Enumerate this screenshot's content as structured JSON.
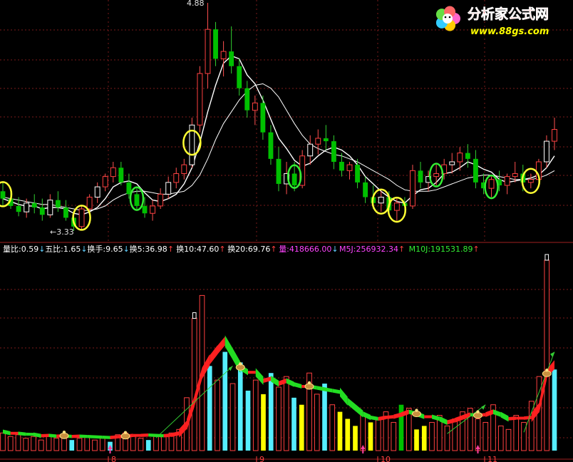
{
  "logo": {
    "name": "分析家公式网",
    "url": "www.88gs.com"
  },
  "colors": {
    "up": "#e00000",
    "down": "#00c000",
    "ma_fast": "#ffffff",
    "ma_slow": "#ffffff",
    "circle_yellow": "#ffff33",
    "circle_green": "#33ee33",
    "vol_cyan": "#55eeff",
    "vol_yellow": "#ffff00",
    "ribbon_red": "#ff2020",
    "ribbon_green": "#22dd22",
    "grid": "#7a1a1a",
    "axis_text": "#ff4040"
  },
  "chart_data": [
    {
      "type": "candlestick",
      "annotations": [
        {
          "text": "4.88",
          "kind": "max"
        },
        {
          "text": "←3.33",
          "kind": "min"
        }
      ],
      "ohlc": [
        [
          3.6,
          3.66,
          3.5,
          3.55
        ],
        [
          3.55,
          3.62,
          3.48,
          3.5
        ],
        [
          3.5,
          3.56,
          3.43,
          3.46
        ],
        [
          3.46,
          3.55,
          3.42,
          3.52
        ],
        [
          3.52,
          3.58,
          3.45,
          3.49
        ],
        [
          3.49,
          3.55,
          3.4,
          3.44
        ],
        [
          3.44,
          3.58,
          3.42,
          3.54
        ],
        [
          3.54,
          3.6,
          3.46,
          3.49
        ],
        [
          3.49,
          3.54,
          3.4,
          3.42
        ],
        [
          3.42,
          3.46,
          3.33,
          3.36
        ],
        [
          3.36,
          3.5,
          3.34,
          3.48
        ],
        [
          3.48,
          3.58,
          3.45,
          3.56
        ],
        [
          3.56,
          3.66,
          3.52,
          3.63
        ],
        [
          3.63,
          3.72,
          3.6,
          3.7
        ],
        [
          3.7,
          3.8,
          3.66,
          3.76
        ],
        [
          3.76,
          3.8,
          3.64,
          3.66
        ],
        [
          3.66,
          3.72,
          3.55,
          3.58
        ],
        [
          3.58,
          3.62,
          3.48,
          3.5
        ],
        [
          3.5,
          3.56,
          3.42,
          3.45
        ],
        [
          3.45,
          3.54,
          3.4,
          3.5
        ],
        [
          3.5,
          3.62,
          3.48,
          3.58
        ],
        [
          3.58,
          3.7,
          3.55,
          3.66
        ],
        [
          3.66,
          3.76,
          3.62,
          3.72
        ],
        [
          3.72,
          3.82,
          3.68,
          3.78
        ],
        [
          3.78,
          4.1,
          3.76,
          4.05
        ],
        [
          4.05,
          4.45,
          4.0,
          4.4
        ],
        [
          4.4,
          4.88,
          4.3,
          4.7
        ],
        [
          4.7,
          4.75,
          4.45,
          4.5
        ],
        [
          4.5,
          4.62,
          4.38,
          4.55
        ],
        [
          4.55,
          4.72,
          4.4,
          4.45
        ],
        [
          4.45,
          4.5,
          4.25,
          4.3
        ],
        [
          4.3,
          4.35,
          4.1,
          4.15
        ],
        [
          4.15,
          4.25,
          4.05,
          4.2
        ],
        [
          4.2,
          4.25,
          3.95,
          4.0
        ],
        [
          4.0,
          4.05,
          3.78,
          3.82
        ],
        [
          3.82,
          3.9,
          3.6,
          3.65
        ],
        [
          3.65,
          3.8,
          3.58,
          3.72
        ],
        [
          3.72,
          3.8,
          3.6,
          3.64
        ],
        [
          3.64,
          3.88,
          3.62,
          3.84
        ],
        [
          3.84,
          3.98,
          3.78,
          3.92
        ],
        [
          3.92,
          4.02,
          3.85,
          3.96
        ],
        [
          3.96,
          4.05,
          3.88,
          3.94
        ],
        [
          3.94,
          3.98,
          3.75,
          3.8
        ],
        [
          3.8,
          3.86,
          3.7,
          3.74
        ],
        [
          3.74,
          3.8,
          3.68,
          3.78
        ],
        [
          3.78,
          3.82,
          3.62,
          3.66
        ],
        [
          3.66,
          3.7,
          3.52,
          3.56
        ],
        [
          3.56,
          3.64,
          3.48,
          3.52
        ],
        [
          3.52,
          3.6,
          3.46,
          3.56
        ],
        [
          3.56,
          3.6,
          3.44,
          3.47
        ],
        [
          3.47,
          3.55,
          3.4,
          3.52
        ],
        [
          3.52,
          3.56,
          3.45,
          3.5
        ],
        [
          3.5,
          3.78,
          3.48,
          3.74
        ],
        [
          3.74,
          3.8,
          3.62,
          3.66
        ],
        [
          3.66,
          3.74,
          3.6,
          3.7
        ],
        [
          3.7,
          3.78,
          3.64,
          3.72
        ],
        [
          3.72,
          3.82,
          3.68,
          3.78
        ],
        [
          3.78,
          3.86,
          3.72,
          3.8
        ],
        [
          3.8,
          3.9,
          3.74,
          3.86
        ],
        [
          3.86,
          3.92,
          3.76,
          3.82
        ],
        [
          3.82,
          3.88,
          3.62,
          3.66
        ],
        [
          3.66,
          3.72,
          3.58,
          3.62
        ],
        [
          3.62,
          3.7,
          3.56,
          3.68
        ],
        [
          3.68,
          3.74,
          3.6,
          3.64
        ],
        [
          3.64,
          3.72,
          3.58,
          3.7
        ],
        [
          3.7,
          3.8,
          3.66,
          3.72
        ],
        [
          3.72,
          3.78,
          3.6,
          3.66
        ],
        [
          3.66,
          3.72,
          3.62,
          3.68
        ],
        [
          3.68,
          3.82,
          3.66,
          3.8
        ],
        [
          3.8,
          3.98,
          3.76,
          3.94
        ],
        [
          3.94,
          4.1,
          3.88,
          4.02
        ]
      ],
      "ma5": [
        3.55,
        3.53,
        3.51,
        3.5,
        3.5,
        3.48,
        3.49,
        3.49,
        3.48,
        3.45,
        3.44,
        3.46,
        3.49,
        3.55,
        3.63,
        3.66,
        3.67,
        3.65,
        3.59,
        3.54,
        3.53,
        3.55,
        3.58,
        3.65,
        3.76,
        3.93,
        4.14,
        4.32,
        4.47,
        4.52,
        4.5,
        4.39,
        4.33,
        4.22,
        4.09,
        3.96,
        3.89,
        3.81,
        3.77,
        3.79,
        3.84,
        3.88,
        3.9,
        3.88,
        3.84,
        3.78,
        3.7,
        3.65,
        3.6,
        3.56,
        3.53,
        3.52,
        3.57,
        3.61,
        3.62,
        3.66,
        3.72,
        3.73,
        3.76,
        3.8,
        3.78,
        3.75,
        3.73,
        3.68,
        3.66,
        3.67,
        3.68,
        3.69,
        3.71,
        3.76,
        3.84
      ],
      "ma10": [
        3.56,
        3.55,
        3.54,
        3.53,
        3.52,
        3.51,
        3.51,
        3.5,
        3.49,
        3.48,
        3.47,
        3.47,
        3.48,
        3.5,
        3.54,
        3.57,
        3.59,
        3.6,
        3.6,
        3.59,
        3.58,
        3.58,
        3.59,
        3.6,
        3.64,
        3.71,
        3.82,
        3.95,
        4.06,
        4.14,
        4.22,
        4.28,
        4.32,
        4.33,
        4.3,
        4.24,
        4.15,
        4.06,
        3.98,
        3.92,
        3.89,
        3.87,
        3.85,
        3.84,
        3.82,
        3.8,
        3.77,
        3.74,
        3.71,
        3.68,
        3.64,
        3.61,
        3.6,
        3.6,
        3.6,
        3.61,
        3.63,
        3.65,
        3.67,
        3.69,
        3.7,
        3.71,
        3.71,
        3.7,
        3.69,
        3.68,
        3.68,
        3.68,
        3.69,
        3.71,
        3.74
      ],
      "yellow_circle_indices": [
        10,
        24,
        0,
        50,
        48,
        67
      ],
      "green_circle_indices": [
        17,
        37,
        55,
        62
      ]
    },
    {
      "type": "bar",
      "indicator_labels": [
        {
          "label": "量比:",
          "value": "0.59",
          "arrow": "↓",
          "color": "#ffffff"
        },
        {
          "label": "五比:",
          "value": "1.65",
          "arrow": "↓",
          "color": "#ffffff"
        },
        {
          "label": "换手:",
          "value": "9.65",
          "arrow": "↓",
          "color": "#ffffff"
        },
        {
          "label": "换5:",
          "value": "36.98",
          "arrow": "↑",
          "color": "#ffffff"
        },
        {
          "label": "换10:",
          "value": "47.60",
          "arrow": "↑",
          "color": "#ffffff"
        },
        {
          "label": "换20:",
          "value": "69.76",
          "arrow": "↑",
          "color": "#ffffff"
        },
        {
          "label": "量:",
          "value": "418666.00",
          "arrow": "↓",
          "color": "#ff44ff"
        },
        {
          "label": "M5J:",
          "value": "256932.34",
          "arrow": "↑",
          "color": "#ff44ff"
        },
        {
          "label": "M10J:",
          "value": "191531.89",
          "arrow": "↑",
          "color": "#33ee33"
        }
      ],
      "x_ticks": [
        "8",
        "9",
        "10",
        "11"
      ],
      "volume": [
        [
          10,
          "red"
        ],
        [
          8,
          "red"
        ],
        [
          9,
          "red"
        ],
        [
          7,
          "red"
        ],
        [
          8,
          "red"
        ],
        [
          6,
          "red"
        ],
        [
          9,
          "red"
        ],
        [
          7,
          "red"
        ],
        [
          8,
          "red"
        ],
        [
          6,
          "cyan"
        ],
        [
          7,
          "red"
        ],
        [
          8,
          "red"
        ],
        [
          6,
          "red"
        ],
        [
          7,
          "red"
        ],
        [
          5,
          "cyan"
        ],
        [
          9,
          "red"
        ],
        [
          10,
          "red"
        ],
        [
          8,
          "red"
        ],
        [
          7,
          "red"
        ],
        [
          6,
          "cyan"
        ],
        [
          8,
          "red"
        ],
        [
          9,
          "red"
        ],
        [
          10,
          "red"
        ],
        [
          12,
          "red"
        ],
        [
          30,
          "red"
        ],
        [
          75,
          "red"
        ],
        [
          88,
          "red"
        ],
        [
          48,
          "cyan"
        ],
        [
          40,
          "red"
        ],
        [
          56,
          "cyan"
        ],
        [
          38,
          "red"
        ],
        [
          50,
          "cyan"
        ],
        [
          34,
          "cyan"
        ],
        [
          40,
          "red"
        ],
        [
          32,
          "yellow"
        ],
        [
          44,
          "cyan"
        ],
        [
          36,
          "red"
        ],
        [
          42,
          "red"
        ],
        [
          30,
          "cyan"
        ],
        [
          26,
          "yellow"
        ],
        [
          44,
          "red"
        ],
        [
          32,
          "red"
        ],
        [
          38,
          "cyan"
        ],
        [
          26,
          "red"
        ],
        [
          22,
          "yellow"
        ],
        [
          18,
          "yellow"
        ],
        [
          14,
          "yellow"
        ],
        [
          20,
          "red"
        ],
        [
          16,
          "yellow"
        ],
        [
          18,
          "red"
        ],
        [
          22,
          "red"
        ],
        [
          16,
          "red"
        ],
        [
          26,
          "green"
        ],
        [
          24,
          "red"
        ],
        [
          12,
          "yellow"
        ],
        [
          14,
          "yellow"
        ],
        [
          16,
          "red"
        ],
        [
          20,
          "red"
        ],
        [
          14,
          "red"
        ],
        [
          18,
          "red"
        ],
        [
          22,
          "red"
        ],
        [
          24,
          "red"
        ],
        [
          18,
          "red"
        ],
        [
          16,
          "red"
        ],
        [
          26,
          "red"
        ],
        [
          14,
          "red"
        ],
        [
          12,
          "red"
        ],
        [
          20,
          "red"
        ],
        [
          16,
          "red"
        ],
        [
          28,
          "red"
        ],
        [
          42,
          "red"
        ],
        [
          108,
          "red"
        ],
        [
          46,
          "cyan"
        ]
      ],
      "gold_marker_indices": [
        8,
        16,
        31,
        40,
        54,
        62,
        71
      ],
      "up_arrow_indices": [
        14,
        47,
        62
      ],
      "red_arrow_ribbon": [
        [
          20,
          30
        ],
        [
          58,
          63
        ],
        [
          68,
          72
        ]
      ]
    }
  ]
}
